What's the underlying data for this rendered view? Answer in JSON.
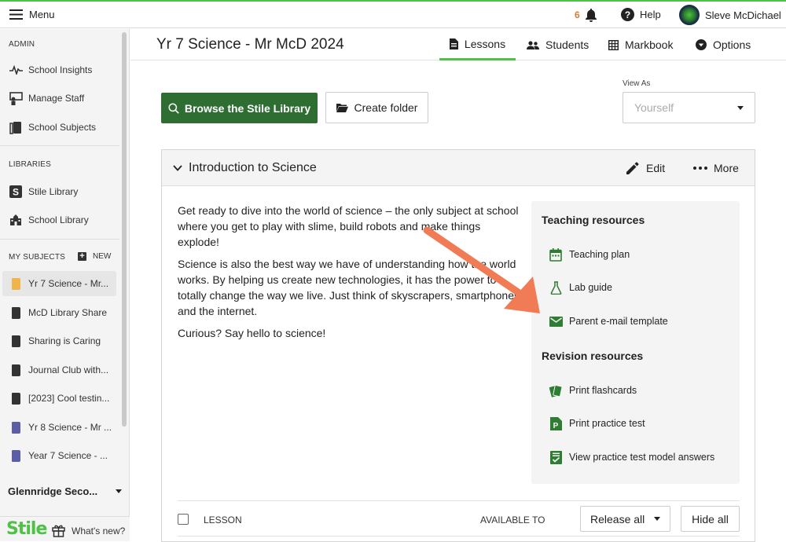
{
  "topbar": {
    "menu_label": "Menu",
    "notification_count": "6",
    "help_label": "Help",
    "user_name": "Sleve McDichael"
  },
  "sidebar": {
    "admin_heading": "ADMIN",
    "admin_items": [
      {
        "label": "School Insights",
        "icon": "pulse-icon"
      },
      {
        "label": "Manage Staff",
        "icon": "staff-icon"
      },
      {
        "label": "School Subjects",
        "icon": "books-icon"
      }
    ],
    "libraries_heading": "LIBRARIES",
    "library_items": [
      {
        "label": "Stile Library",
        "icon": "stile-s-icon"
      },
      {
        "label": "School Library",
        "icon": "school-icon"
      }
    ],
    "subjects_heading": "MY SUBJECTS",
    "new_label": "NEW",
    "subject_items": [
      {
        "label": "Yr 7 Science - Mr...",
        "color": "#f0b44c",
        "active": true
      },
      {
        "label": "McD Library Share",
        "color": "#333333"
      },
      {
        "label": "Sharing is Caring",
        "color": "#333333"
      },
      {
        "label": "Journal Club with...",
        "color": "#333333"
      },
      {
        "label": "[2023] Cool testin...",
        "color": "#333333"
      },
      {
        "label": "Yr 8 Science - Mr ...",
        "color": "#5b5ea6"
      },
      {
        "label": "Year 7 Science - ...",
        "color": "#5b5ea6"
      }
    ],
    "school_name": "Glennridge Seco...",
    "logo_text": "Stile",
    "whats_new_label": "What's new?"
  },
  "header": {
    "page_title": "Yr 7 Science - Mr McD 2024",
    "tabs": [
      {
        "label": "Lessons",
        "icon": "document-icon",
        "active": true
      },
      {
        "label": "Students",
        "icon": "people-icon"
      },
      {
        "label": "Markbook",
        "icon": "grid-icon"
      },
      {
        "label": "Options",
        "icon": "options-icon"
      }
    ]
  },
  "toolbar": {
    "browse_label": "Browse the Stile Library",
    "create_folder_label": "Create folder",
    "view_as_label": "View As",
    "view_as_value": "Yourself"
  },
  "panel": {
    "title": "Introduction to Science",
    "edit_label": "Edit",
    "more_label": "More",
    "description": [
      "Get ready to dive into the world of science – the only subject at school where you get to play with slime, build robots and make things explode!",
      "Science is also the best way we have of understanding how the world works. By helping us create new technologies, it has the power to totally change the way we live. Just think of skyscrapers, smartphones and the internet.",
      "Curious? Say hello to science!"
    ],
    "teaching_heading": "Teaching resources",
    "teaching_items": [
      {
        "label": "Teaching plan",
        "icon": "calendar-icon"
      },
      {
        "label": "Lab guide",
        "icon": "flask-icon"
      },
      {
        "label": "Parent e-mail template",
        "icon": "email-icon"
      }
    ],
    "revision_heading": "Revision resources",
    "revision_items": [
      {
        "label": "Print flashcards",
        "icon": "flashcards-icon"
      },
      {
        "label": "Print practice test",
        "icon": "practice-test-icon"
      },
      {
        "label": "View practice test model answers",
        "icon": "model-answers-icon"
      }
    ],
    "accent_color": "#2e7d32",
    "arrow_color": "#f07b55"
  },
  "table": {
    "col_lesson": "LESSON",
    "col_available": "AVAILABLE TO",
    "release_all_label": "Release all",
    "hide_all_label": "Hide all"
  }
}
